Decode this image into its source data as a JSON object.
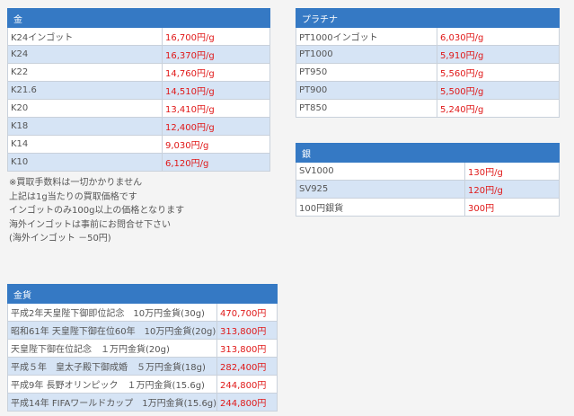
{
  "gold": {
    "title": "金",
    "rows": [
      {
        "name": "K24インゴット",
        "price": "16,700円/g"
      },
      {
        "name": "K24",
        "price": "16,370円/g"
      },
      {
        "name": "K22",
        "price": "14,760円/g"
      },
      {
        "name": "K21.6",
        "price": "14,510円/g"
      },
      {
        "name": "K20",
        "price": "13,410円/g"
      },
      {
        "name": "K18",
        "price": "12,400円/g"
      },
      {
        "name": "K14",
        "price": "9,030円/g"
      },
      {
        "name": "K10",
        "price": "6,120円/g"
      }
    ]
  },
  "notes": [
    "※買取手数料は一切かかりません",
    "上記は1g当たりの買取価格です",
    "インゴットのみ100g以上の価格となります",
    "海外インゴットは事前にお問合せ下さい",
    "(海外インゴット －50円)"
  ],
  "platinum": {
    "title": "プラチナ",
    "rows": [
      {
        "name": "PT1000インゴット",
        "price": "6,030円/g"
      },
      {
        "name": "PT1000",
        "price": "5,910円/g"
      },
      {
        "name": "PT950",
        "price": "5,560円/g"
      },
      {
        "name": "PT900",
        "price": "5,500円/g"
      },
      {
        "name": "PT850",
        "price": "5,240円/g"
      }
    ]
  },
  "silver": {
    "title": "銀",
    "rows": [
      {
        "name": "SV1000",
        "price": "130円/g"
      },
      {
        "name": "SV925",
        "price": "120円/g"
      },
      {
        "name": "100円銀貨",
        "price": "300円"
      }
    ]
  },
  "coins": {
    "title": "金貨",
    "rows": [
      {
        "name": "平成2年天皇陛下御即位記念　10万円金貨(30g)",
        "price": "470,700円"
      },
      {
        "name": "昭和61年 天皇陛下御在位60年　10万円金貨(20g)",
        "price": "313,800円"
      },
      {
        "name": "天皇陛下御在位記念　１万円金貨(20g)",
        "price": "313,800円"
      },
      {
        "name": "平成５年　皇太子殿下御成婚　５万円金貨(18g)",
        "price": "282,400円"
      },
      {
        "name": "平成9年 長野オリンピック　１万円金貨(15.6g)",
        "price": "244,800円"
      },
      {
        "name": "平成14年 FIFAワールドカップ　1万円金貨(15.6g)",
        "price": "244,800円"
      }
    ]
  }
}
